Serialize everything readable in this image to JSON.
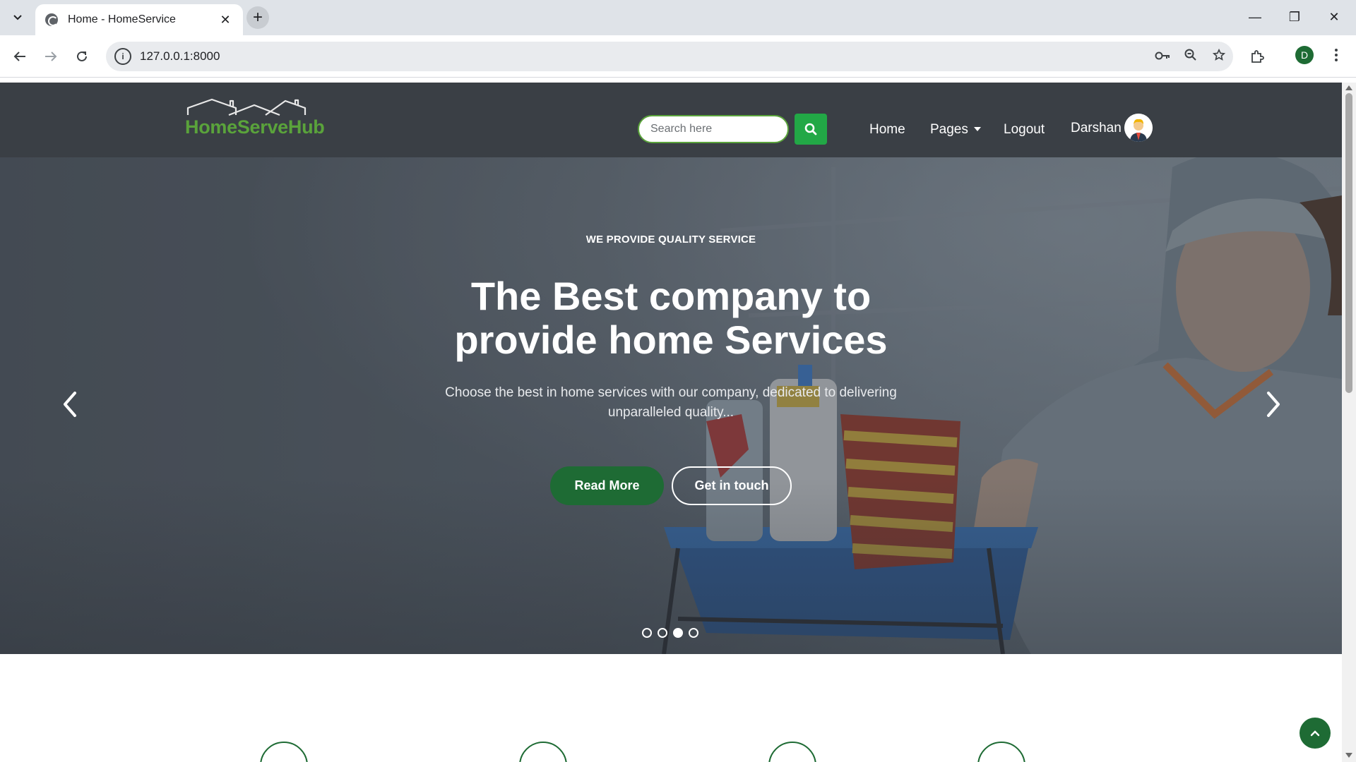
{
  "browser": {
    "tab_title": "Home - HomeService",
    "tab_close": "✕",
    "new_tab": "+",
    "url": "127.0.0.1:8000",
    "profile_initial": "D",
    "window": {
      "minimize": "—",
      "restore": "❐",
      "close": "✕"
    }
  },
  "navbar": {
    "logo_text": "HomeServeHub",
    "search_placeholder": "Search here",
    "links": {
      "home": "Home",
      "pages": "Pages",
      "logout": "Logout"
    },
    "user_name": "Darshan"
  },
  "hero": {
    "eyebrow": "WE PROVIDE QUALITY SERVICE",
    "headline_line1": "The Best company to",
    "headline_line2": "provide home Services",
    "subtext_line1": "Choose the best in home services with our company, dedicated to delivering",
    "subtext_line2": "unparalleled quality...",
    "read_more": "Read More",
    "get_in_touch": "Get in touch",
    "slide_count": 4,
    "active_slide": 3
  },
  "colors": {
    "brand_green": "#1e6b34",
    "logo_green": "#5aa33b",
    "search_green": "#22a846",
    "navbar_bg": "#3a3f45"
  },
  "icons": {
    "search": "search-icon",
    "prev": "chevron-left-icon",
    "next": "chevron-right-icon",
    "back_to_top": "chevron-up-icon"
  }
}
